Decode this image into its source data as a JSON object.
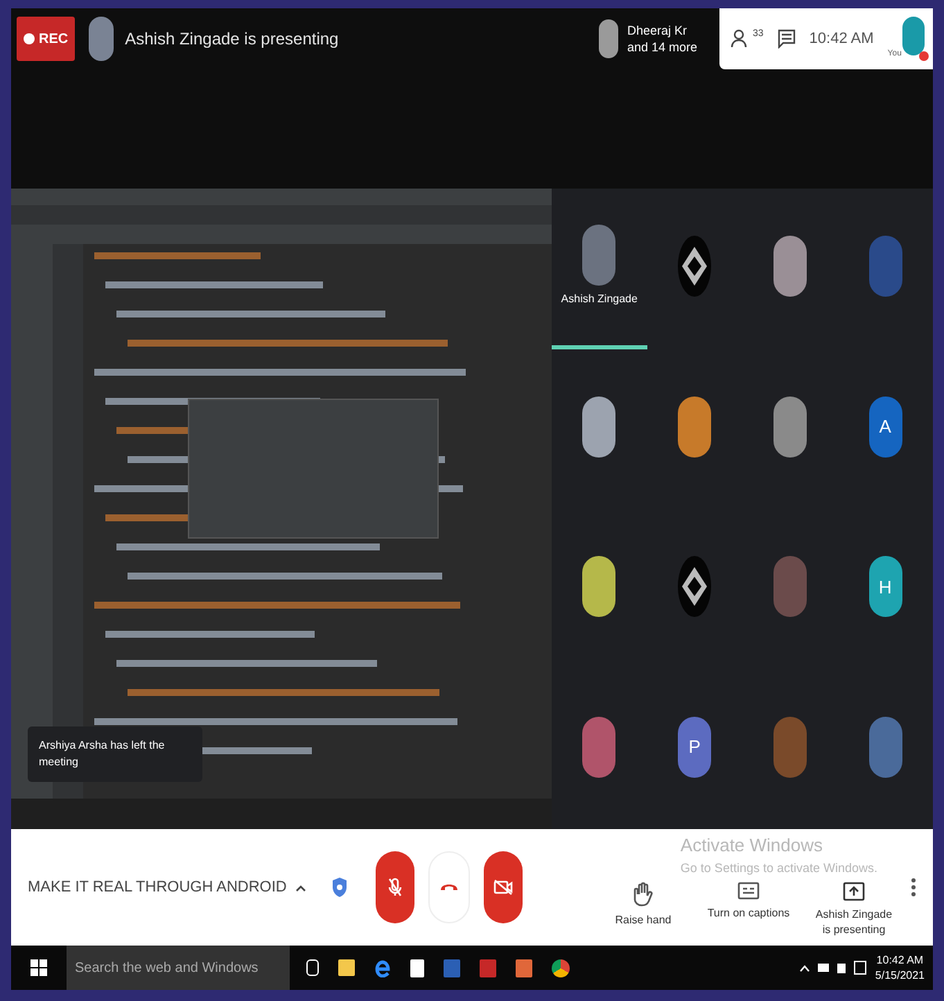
{
  "top_bar": {
    "rec_label": "REC",
    "presenter_text": "Ashish Zingade is presenting",
    "others": {
      "line_1": "Dheeraj Kr",
      "line_2": "and 14 more"
    },
    "people_count": "33",
    "time": "10:42 AM",
    "self_label": "You"
  },
  "shared_screen": {
    "toast": "Arshiya Arsha has left the meeting"
  },
  "participants": [
    {
      "kind": "photo",
      "color": "#6b7280",
      "name": "Ashish Zingade",
      "highlighted": true
    },
    {
      "kind": "logo",
      "highlighted": false
    },
    {
      "kind": "photo",
      "color": "#9a8f96",
      "highlighted": false
    },
    {
      "kind": "photo",
      "color": "#2a4a8a",
      "highlighted": false
    },
    {
      "kind": "photo",
      "color": "#9ca3af",
      "highlighted": false
    },
    {
      "kind": "photo",
      "color": "#c77a2a",
      "highlighted": false
    },
    {
      "kind": "photo",
      "color": "#8a8a8a",
      "highlighted": false
    },
    {
      "kind": "letter",
      "letter": "A",
      "color": "#1565c0",
      "highlighted": false
    },
    {
      "kind": "photo",
      "color": "#b5b84a",
      "highlighted": false
    },
    {
      "kind": "logo",
      "highlighted": false
    },
    {
      "kind": "photo",
      "color": "#6b4b4b",
      "highlighted": false
    },
    {
      "kind": "letter",
      "letter": "H",
      "color": "#1ea4b0",
      "highlighted": false
    },
    {
      "kind": "photo",
      "color": "#b0546a",
      "highlighted": false
    },
    {
      "kind": "letter",
      "letter": "P",
      "color": "#5c6bc0",
      "highlighted": false
    },
    {
      "kind": "photo",
      "color": "#7a4a2a",
      "highlighted": false
    },
    {
      "kind": "photo",
      "color": "#4a6a9a",
      "highlighted": false
    }
  ],
  "bottom_bar": {
    "meeting_title": "MAKE IT REAL THROUGH ANDROID",
    "mic_muted": true,
    "camera_off": true,
    "actions": [
      {
        "kind": "hand",
        "label": "Raise hand"
      },
      {
        "kind": "captions",
        "label": "Turn on captions"
      },
      {
        "kind": "present",
        "label": "Ashish Zingade is presenting"
      }
    ],
    "activation": {
      "title": "Activate Windows",
      "text": "Go to Settings to activate Windows."
    }
  },
  "taskbar": {
    "search_placeholder": "Search the web and Windows",
    "time": "10:42 AM",
    "date": "5/15/2021"
  }
}
